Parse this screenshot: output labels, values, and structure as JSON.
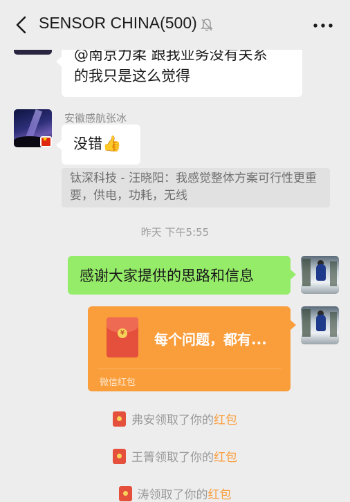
{
  "header": {
    "title": "SENSOR CHINA(500)"
  },
  "messages": {
    "top_bubble_lines": [
      "@南京力柔  跟我业务没有关系",
      "的我只是这么觉得"
    ],
    "sender_name": "安徽感航张冰",
    "reply_text": "没错",
    "reply_emoji": "👍",
    "quote_text": "钛深科技 - 汪晓阳：我感觉整体方案可行性更重要，供电，功耗，无线",
    "timestamp": "昨天 下午5:55",
    "my_message": "感谢大家提供的思路和信息",
    "red_packet": {
      "title": "每个问题，都有...",
      "label": "微信红包",
      "coin_symbol": "¥"
    }
  },
  "system_notices": [
    {
      "prefix": "弗安领取了你的",
      "link": "红包"
    },
    {
      "prefix": "王箐领取了你的",
      "link": "红包"
    },
    {
      "prefix": "涛领取了你的",
      "link": "红包"
    }
  ],
  "colors": {
    "background": "#ededed",
    "my_bubble": "#95ec69",
    "red_packet": "#fa9d3b",
    "link": "#fa9d3b"
  }
}
